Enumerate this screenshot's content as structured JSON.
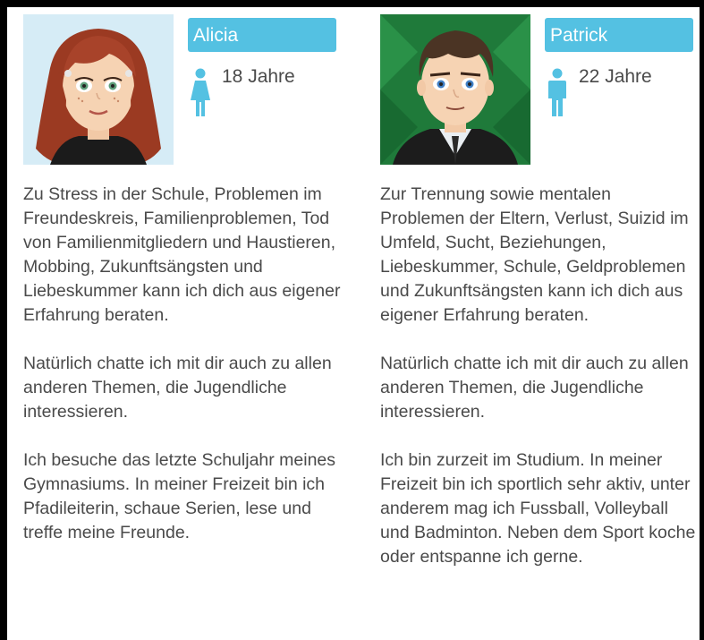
{
  "profiles": [
    {
      "name": "Alicia",
      "age": "18 Jahre",
      "gender_icon": "female-icon",
      "paragraphs": [
        "Zu Stress in der Schule, Problemen im Freundeskreis, Familienproblemen, Tod von Familienmitgliedern und Haustieren, Mobbing, Zukunftsängsten und Liebeskummer kann ich dich aus eigener Erfahrung beraten.",
        "Natürlich chatte ich mit dir auch zu allen anderen Themen, die Jugendliche interessieren.",
        "Ich besuche das letzte Schuljahr meines Gymnasiums. In meiner Freizeit bin ich Pfadileiterin, schaue Serien, lese und treffe meine Freunde."
      ]
    },
    {
      "name": "Patrick",
      "age": "22 Jahre",
      "gender_icon": "male-icon",
      "paragraphs": [
        "Zur Trennung sowie mentalen Problemen der Eltern, Verlust, Suizid im Umfeld, Sucht, Beziehungen, Liebeskummer, Schule, Geldproblemen und Zukunftsängsten kann ich dich aus eigener Erfahrung beraten.",
        "Natürlich chatte ich mit dir auch zu allen anderen Themen, die Jugendliche interessieren.",
        "Ich bin zurzeit im Studium. In meiner Freizeit bin ich sportlich sehr aktiv, unter anderem mag ich Fussball, Volleyball und Badminton. Neben dem Sport koche oder entspanne ich gerne."
      ]
    }
  ],
  "colors": {
    "accent": "#54c1e2",
    "text": "#4a4a4a",
    "frame": "#000000"
  }
}
